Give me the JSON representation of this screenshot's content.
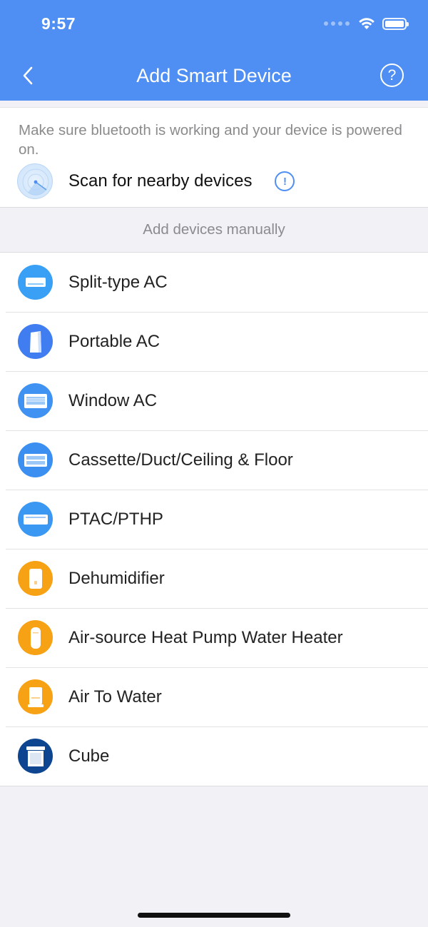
{
  "status_bar": {
    "time": "9:57"
  },
  "nav": {
    "title": "Add Smart Device"
  },
  "scan": {
    "note": "Make sure bluetooth is working and your device is powered on.",
    "label": "Scan for nearby devices"
  },
  "manual": {
    "header": "Add devices manually"
  },
  "devices": [
    {
      "label": "Split-type AC",
      "icon": "split-ac-icon",
      "color": "#3aa0f5"
    },
    {
      "label": "Portable AC",
      "icon": "portable-ac-icon",
      "color": "#3f7df0"
    },
    {
      "label": "Window AC",
      "icon": "window-ac-icon",
      "color": "#3f92f1"
    },
    {
      "label": "Cassette/Duct/Ceiling & Floor",
      "icon": "cassette-ac-icon",
      "color": "#3a8ff0"
    },
    {
      "label": "PTAC/PTHP",
      "icon": "ptac-icon",
      "color": "#3a98f3"
    },
    {
      "label": "Dehumidifier",
      "icon": "dehumidifier-icon",
      "color": "#f7a114"
    },
    {
      "label": "Air-source Heat Pump Water Heater",
      "icon": "heat-pump-water-heater-icon",
      "color": "#f7a114"
    },
    {
      "label": "Air To Water",
      "icon": "air-to-water-icon",
      "color": "#f7a114"
    },
    {
      "label": "Cube",
      "icon": "cube-icon",
      "color": "#0d4590"
    }
  ]
}
